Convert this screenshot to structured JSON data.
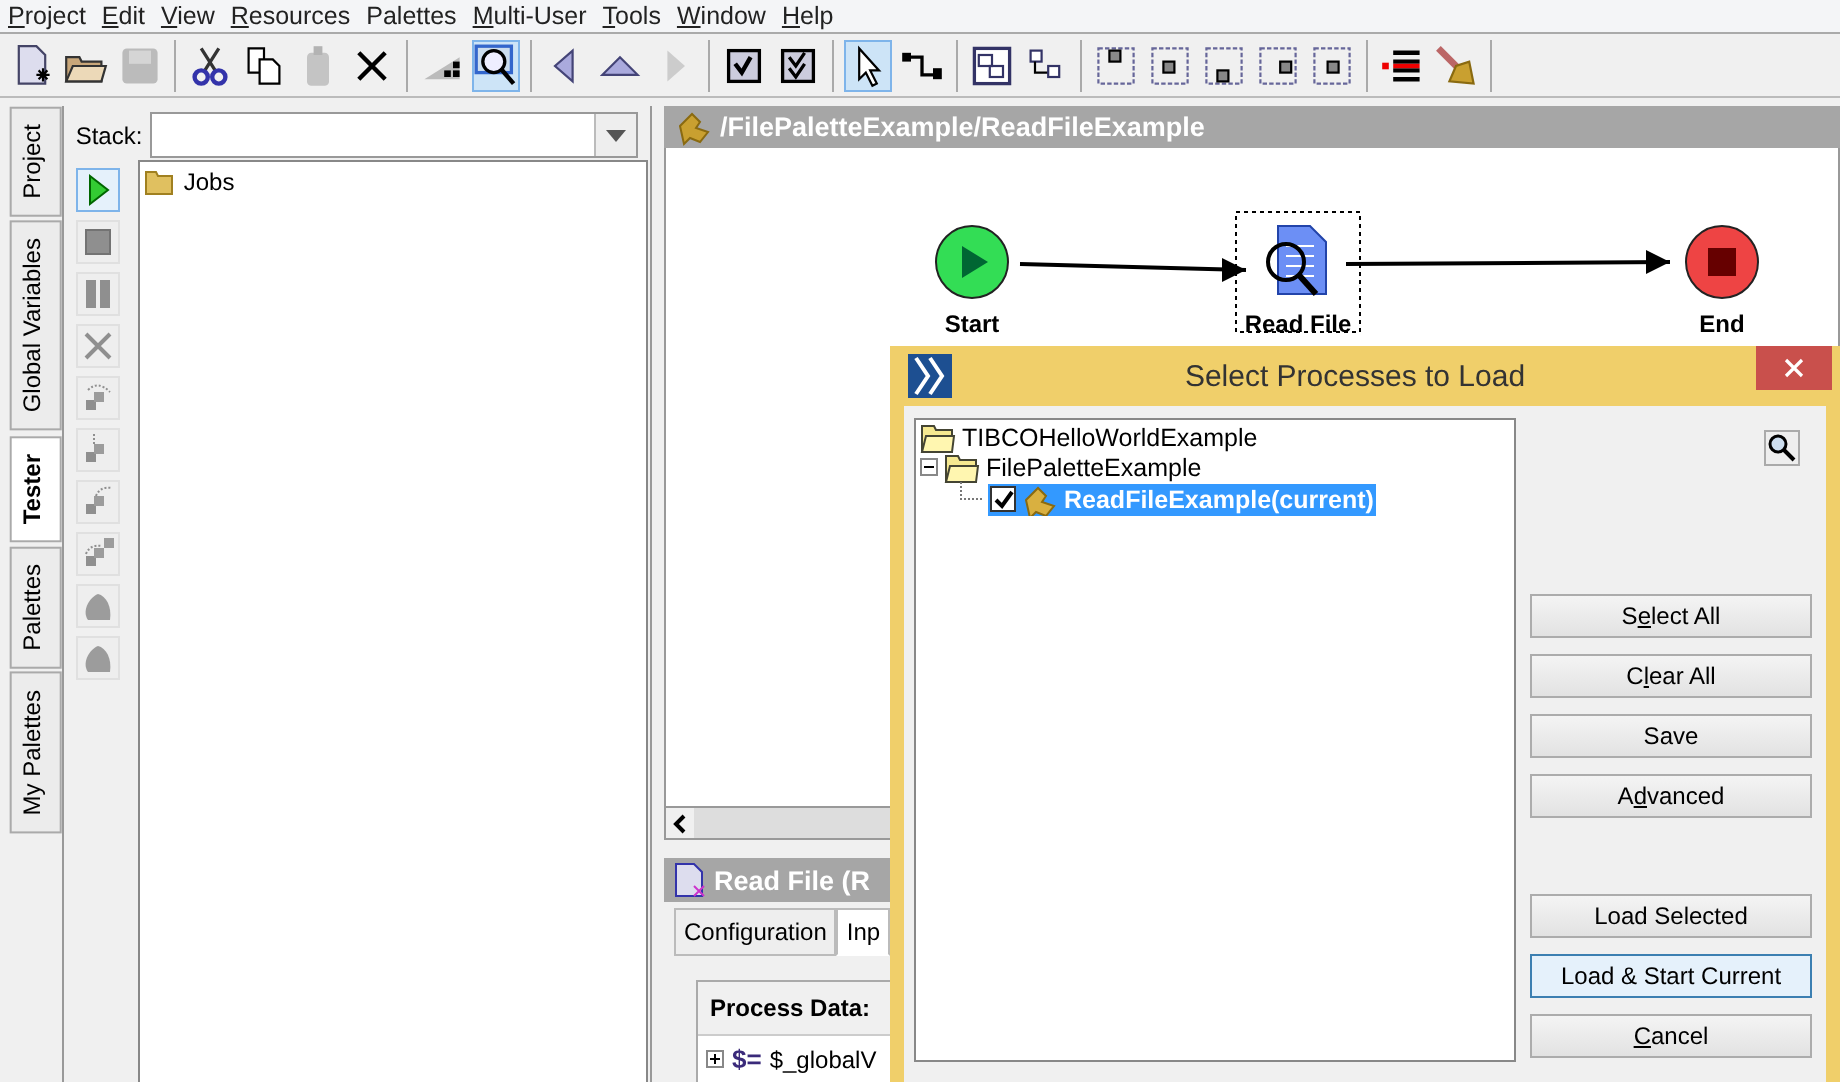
{
  "menu": [
    {
      "label": "Project",
      "first_letter_underlined": true
    },
    {
      "label": "Edit",
      "first_letter_underlined": true
    },
    {
      "label": "View",
      "first_letter_underlined": true
    },
    {
      "label": "Resources",
      "first_letter_underlined": true
    },
    {
      "label": "Palettes",
      "first_letter_underlined": false
    },
    {
      "label": "Multi-User",
      "first_letter_underlined": true
    },
    {
      "label": "Tools",
      "first_letter_underlined": true
    },
    {
      "label": "Window",
      "first_letter_underlined": true
    },
    {
      "label": "Help",
      "first_letter_underlined": true
    }
  ],
  "toolbar": {
    "groups": [
      [
        {
          "kind": "new",
          "disabled": false,
          "selected": false
        },
        {
          "kind": "open",
          "disabled": false,
          "selected": false
        },
        {
          "kind": "save",
          "disabled": true,
          "selected": false
        }
      ],
      [
        {
          "kind": "cut",
          "disabled": false,
          "selected": false
        },
        {
          "kind": "copy",
          "disabled": false,
          "selected": false
        },
        {
          "kind": "paste",
          "disabled": true,
          "selected": false
        },
        {
          "kind": "delete",
          "disabled": false,
          "selected": false
        }
      ],
      [
        {
          "kind": "steps",
          "disabled": false,
          "selected": false
        },
        {
          "kind": "zoom",
          "disabled": false,
          "selected": true
        }
      ],
      [
        {
          "kind": "back",
          "disabled": false,
          "selected": false
        },
        {
          "kind": "up",
          "disabled": false,
          "selected": false
        },
        {
          "kind": "forward",
          "disabled": true,
          "selected": false
        }
      ],
      [
        {
          "kind": "check",
          "disabled": false,
          "selected": false
        },
        {
          "kind": "check_double",
          "disabled": false,
          "selected": false
        }
      ],
      [
        {
          "kind": "pointer",
          "disabled": false,
          "selected": true
        },
        {
          "kind": "connector",
          "disabled": false,
          "selected": false
        }
      ],
      [
        {
          "kind": "group",
          "disabled": false,
          "selected": false
        },
        {
          "kind": "tree",
          "disabled": false,
          "selected": false
        }
      ],
      [
        {
          "kind": "align_top",
          "disabled": false,
          "selected": false
        },
        {
          "kind": "align_middle",
          "disabled": false,
          "selected": false
        },
        {
          "kind": "align_bottom",
          "disabled": false,
          "selected": false
        },
        {
          "kind": "align_right",
          "disabled": false,
          "selected": false
        },
        {
          "kind": "align_center",
          "disabled": false,
          "selected": false
        }
      ],
      [
        {
          "kind": "breakpoints",
          "disabled": false,
          "selected": false
        },
        {
          "kind": "broom",
          "disabled": false,
          "selected": false
        }
      ]
    ]
  },
  "side_tabs": [
    {
      "label": "Project",
      "selected": false
    },
    {
      "label": "Global Variables",
      "selected": false
    },
    {
      "label": "Tester",
      "selected": true
    },
    {
      "label": "Palettes",
      "selected": false
    },
    {
      "label": "My Palettes",
      "selected": false
    }
  ],
  "tester": {
    "stack_label": "Stack:",
    "controls": [
      {
        "kind": "run",
        "disabled": false,
        "selected": true
      },
      {
        "kind": "stop",
        "disabled": true,
        "selected": false
      },
      {
        "kind": "pause",
        "disabled": true,
        "selected": false
      },
      {
        "kind": "kill",
        "disabled": true,
        "selected": false
      },
      {
        "kind": "step_over",
        "disabled": true,
        "selected": false
      },
      {
        "kind": "step_into",
        "disabled": true,
        "selected": false
      },
      {
        "kind": "step_out",
        "disabled": true,
        "selected": false
      },
      {
        "kind": "step_add",
        "disabled": true,
        "selected": false
      },
      {
        "kind": "blob",
        "disabled": true,
        "selected": false
      },
      {
        "kind": "blob",
        "disabled": true,
        "selected": false
      }
    ],
    "tree": [
      {
        "label": "Jobs"
      }
    ]
  },
  "editor": {
    "title": "/FilePaletteExample/ReadFileExample",
    "nodes": [
      {
        "kind": "start",
        "label": "Start",
        "selected": false
      },
      {
        "kind": "read_file",
        "label": "Read File",
        "selected": true
      },
      {
        "kind": "end",
        "label": "End",
        "selected": false
      }
    ]
  },
  "properties": {
    "title": "Read File (R",
    "tabs": [
      {
        "label": "Configuration",
        "selected": false
      },
      {
        "label": "Inp",
        "selected": true
      }
    ],
    "process_data": {
      "label": "Process Data:",
      "rows": [
        {
          "symbol": "$=",
          "label": "$_globalV",
          "expanded": false
        }
      ]
    }
  },
  "dialog": {
    "title": "Select Processes to Load",
    "tree": [
      {
        "label": "TIBCOHelloWorldExample"
      },
      {
        "label": "FilePaletteExample",
        "expanded": true,
        "children": [
          {
            "label": "ReadFileExample(current)",
            "checked": true,
            "selected": true
          }
        ]
      }
    ],
    "buttons": [
      {
        "label": "Select All",
        "first_letter_underlined": false,
        "second_letter_underlined": true,
        "focused": false
      },
      {
        "label": "Clear All",
        "first_letter_underlined": false,
        "second_letter_underlined": true,
        "focused": false
      },
      {
        "label": "Save",
        "first_letter_underlined": false,
        "second_letter_underlined": false,
        "focused": false
      },
      {
        "label": "Advanced",
        "first_letter_underlined": false,
        "second_letter_underlined": true,
        "focused": false
      },
      {
        "label": "Load Selected",
        "first_letter_underlined": false,
        "second_letter_underlined": false,
        "focused": false
      },
      {
        "label": "Load & Start Current",
        "first_letter_underlined": false,
        "second_letter_underlined": false,
        "focused": true
      },
      {
        "label": "Cancel",
        "first_letter_underlined": true,
        "second_letter_underlined": false,
        "focused": false
      }
    ]
  }
}
